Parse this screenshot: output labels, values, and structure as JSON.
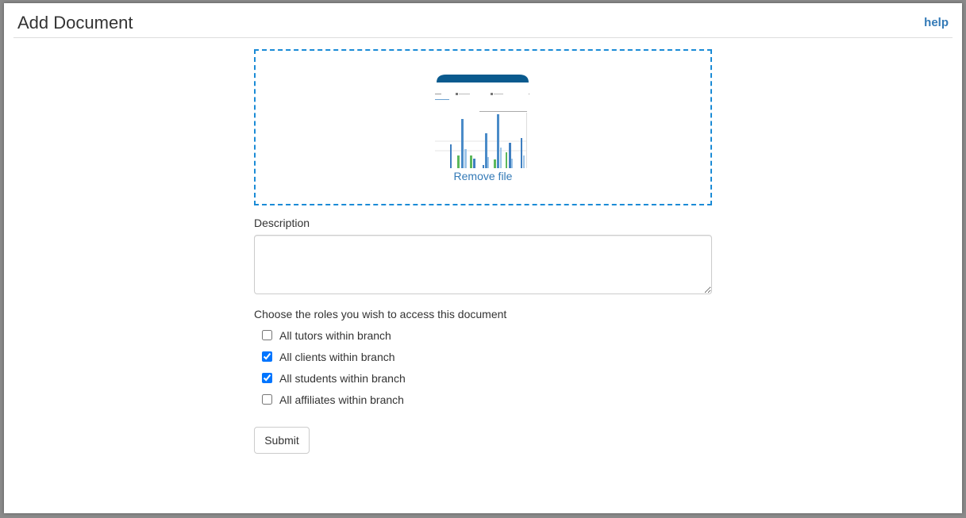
{
  "header": {
    "title": "Add Document",
    "help_label": "help"
  },
  "dropzone": {
    "remove_label": "Remove file",
    "accent_color": "#1b8bd6"
  },
  "form": {
    "description_label": "Description",
    "description_value": "",
    "roles_label": "Choose the roles you wish to access this document",
    "roles": [
      {
        "label": "All tutors within branch",
        "checked": false
      },
      {
        "label": "All clients within branch",
        "checked": true
      },
      {
        "label": "All students within branch",
        "checked": true
      },
      {
        "label": "All affiliates within branch",
        "checked": false
      }
    ],
    "submit_label": "Submit"
  },
  "colors": {
    "link": "#337ab7",
    "text": "#333333"
  }
}
